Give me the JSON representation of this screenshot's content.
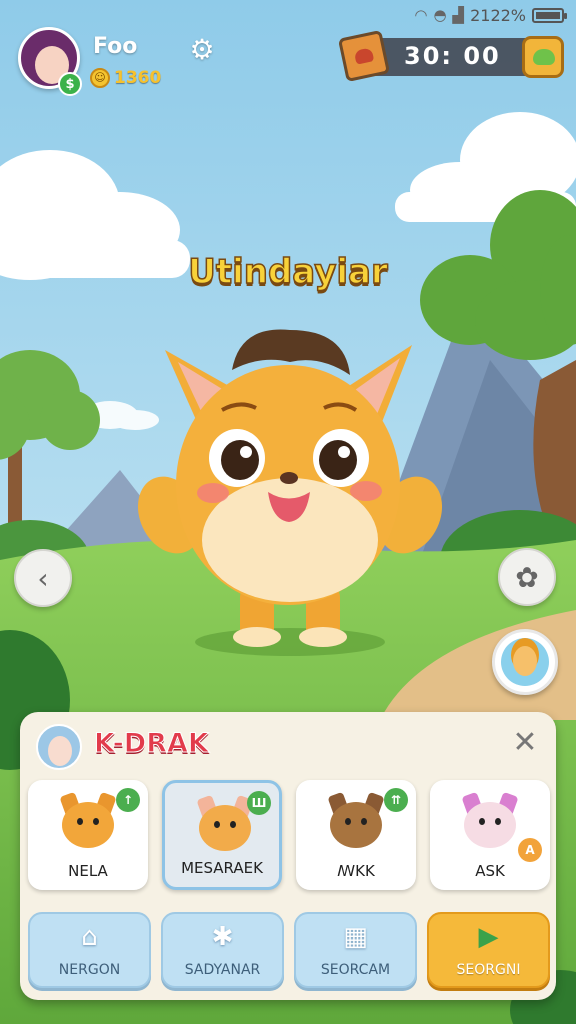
{
  "status_bar": {
    "battery_text": "2122%",
    "battery_level": 0.85
  },
  "player": {
    "name": "Foo",
    "badge": "$",
    "coins": "1360"
  },
  "timer": {
    "text": "30:  00"
  },
  "character": {
    "title": "Utindayiar"
  },
  "panel": {
    "title": "K-DRAK",
    "cards": [
      {
        "label": "NELA",
        "badge": "↑",
        "extra_badge": ""
      },
      {
        "label": "MESARAEK",
        "badge": "Ш",
        "extra_badge": ""
      },
      {
        "label": "ꟿKK",
        "badge": "⇈",
        "extra_badge": ""
      },
      {
        "label": "ASK",
        "badge": "",
        "extra_badge": "A"
      }
    ],
    "actions": [
      {
        "label": "NERGON",
        "icon": "home-icon"
      },
      {
        "label": "SADYANAR",
        "icon": "star-icon"
      },
      {
        "label": "SEORCAM",
        "icon": "grid-icon"
      },
      {
        "label": "SEORGNI",
        "icon": "play-icon"
      }
    ]
  },
  "colors": {
    "title_yellow": "#f8d23a",
    "panel_title_red": "#e23b4b",
    "primary_orange": "#f5b93a",
    "action_blue": "#bfe0f3"
  }
}
